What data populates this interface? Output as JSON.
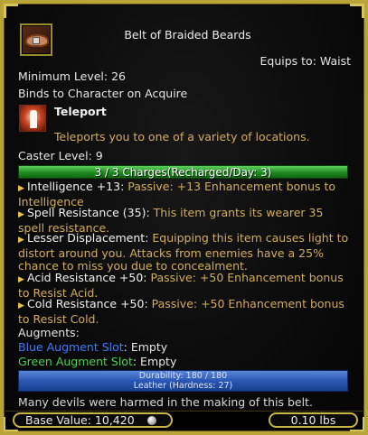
{
  "item": {
    "name": "Belt of Braided Beards",
    "equips_to": "Equips to: Waist",
    "minimum_level": "Minimum Level: 26",
    "binding": "Binds to Character on Acquire"
  },
  "spell": {
    "name": "Teleport",
    "description": "Teleports you to one of a variety of locations.",
    "caster_level": "Caster Level: 9",
    "icon": "teleport-figure-icon"
  },
  "charges": {
    "text": "3 / 3 Charges(Recharged/Day: 3)",
    "current": 3,
    "max": 3,
    "color": "#2ea52e"
  },
  "effects": [
    {
      "name": "Intelligence +13:",
      "desc_first": " Passive: +13 Enhancement bonus to",
      "desc_rest": "Intelligence"
    },
    {
      "name": "Spell Resistance (35):",
      "desc_first": " This item grants its wearer 35",
      "desc_rest": "spell resistance."
    },
    {
      "name": "Lesser Displacement:",
      "desc_first": " Equipping this item causes light to",
      "desc_rest": "distort around you. Attacks from enemies have a 25% chance to miss you due to concealment."
    },
    {
      "name": "Acid Resistance +50:",
      "desc_first": " Passive: +50 Enhancement bonus",
      "desc_rest": "to Resist Acid."
    },
    {
      "name": "Cold Resistance +50:",
      "desc_first": " Passive: +50 Enhancement bonus",
      "desc_rest": "to Resist Cold."
    }
  ],
  "augments": {
    "label": "Augments:",
    "slots": [
      {
        "slot": "Blue Augment Slot",
        "value": ": Empty",
        "color": "#3a7dff"
      },
      {
        "slot": "Green Augment Slot",
        "value": ": Empty",
        "color": "#4cd24c"
      }
    ]
  },
  "durability": {
    "text": "Durability: 180 / 180",
    "material": "Leather (Hardness: 27)",
    "current": 180,
    "max": 180,
    "color": "#2a57b2"
  },
  "flavor_text": "Many devils were harmed in the making of this belt.",
  "footer": {
    "base_value": "Base Value: 10,420",
    "currency_icon": "coin-icon",
    "weight": "0.10 lbs"
  },
  "colors": {
    "border": "#b8a437",
    "effect_text": "#d2ad5e"
  }
}
